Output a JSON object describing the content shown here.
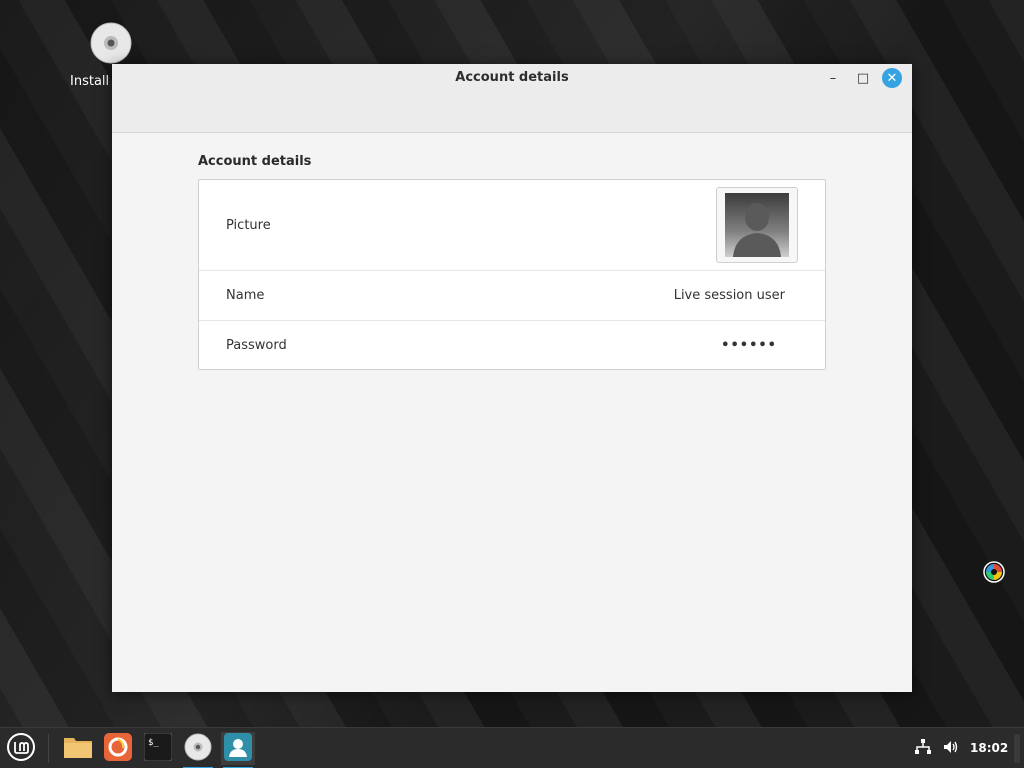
{
  "desktop": {
    "icons": [
      {
        "label": "Install"
      }
    ]
  },
  "window": {
    "title": "Account details",
    "controls": {
      "minimize": "–",
      "maximize": "□",
      "close": "✕"
    },
    "section_title": "Account details",
    "rows": [
      {
        "label": "Picture",
        "value": ""
      },
      {
        "label": "Name",
        "value": "Live session user"
      },
      {
        "label": "Password",
        "value": "••••••"
      }
    ]
  },
  "taskbar": {
    "clock": "18:02",
    "apps": [
      "menu-icon",
      "files-icon",
      "firefox-icon",
      "terminal-icon",
      "disc-icon",
      "account-icon"
    ]
  },
  "colors": {
    "accent": "#35a3e0",
    "taskbar": "#2b2b2b",
    "window_bg": "#f4f4f4"
  }
}
